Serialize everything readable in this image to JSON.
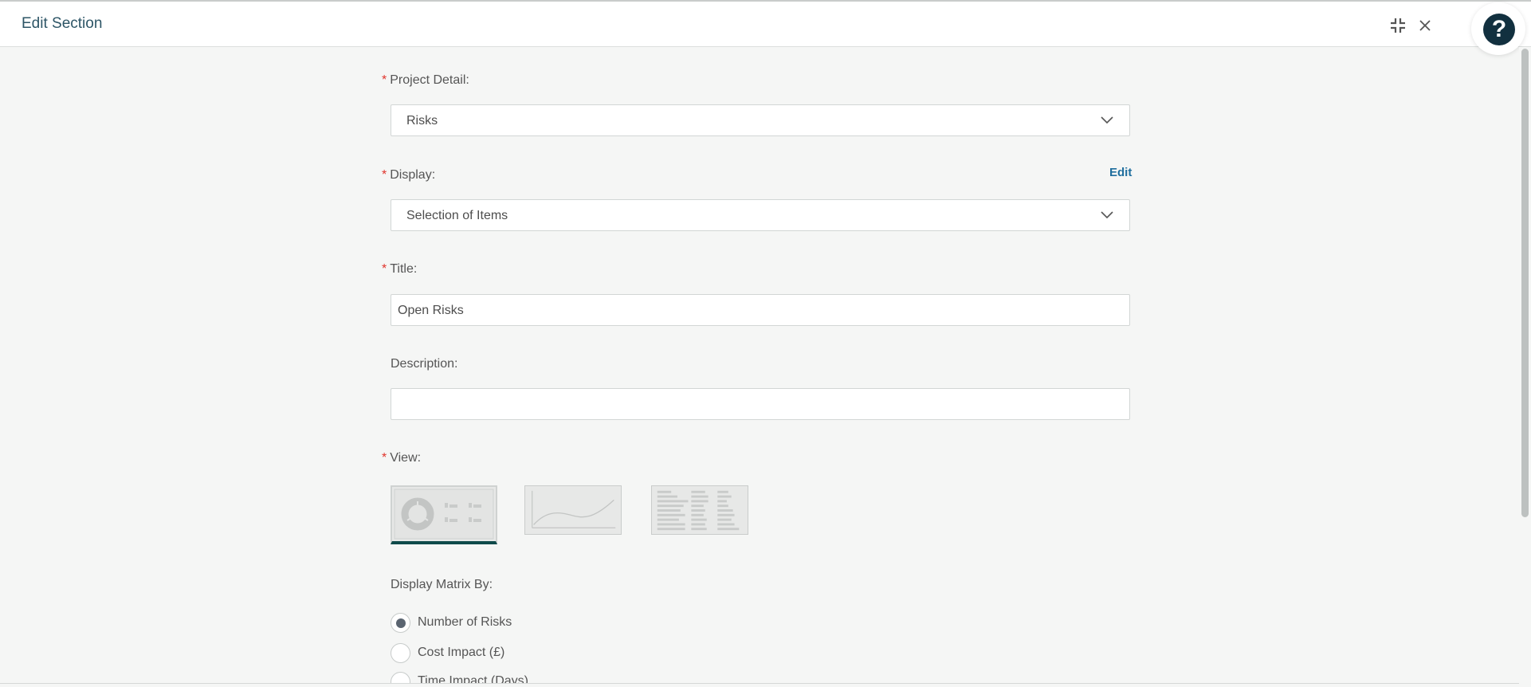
{
  "header": {
    "title": "Edit Section",
    "collapse_icon": "collapse-icon",
    "close_icon": "close-icon",
    "help_label": "?"
  },
  "form": {
    "required_marker": "*",
    "project_detail": {
      "label": "Project Detail:",
      "value": "Risks"
    },
    "display": {
      "label": "Display:",
      "value": "Selection of Items",
      "edit_label": "Edit"
    },
    "title": {
      "label": "Title:",
      "value": "Open Risks"
    },
    "description": {
      "label": "Description:",
      "value": ""
    },
    "view": {
      "label": "View:",
      "options": [
        "donut-chart-view",
        "line-chart-view",
        "list-view"
      ],
      "selected_index": 0
    },
    "display_matrix": {
      "label": "Display Matrix By:",
      "options": [
        "Number of Risks",
        "Cost Impact (£)",
        "Time Impact (Days)"
      ],
      "selected_index": 0
    }
  },
  "colors": {
    "accent": "#0f4a4a",
    "required": "#e0342c",
    "link": "#1f6e9e",
    "help_button": "#12303f"
  }
}
